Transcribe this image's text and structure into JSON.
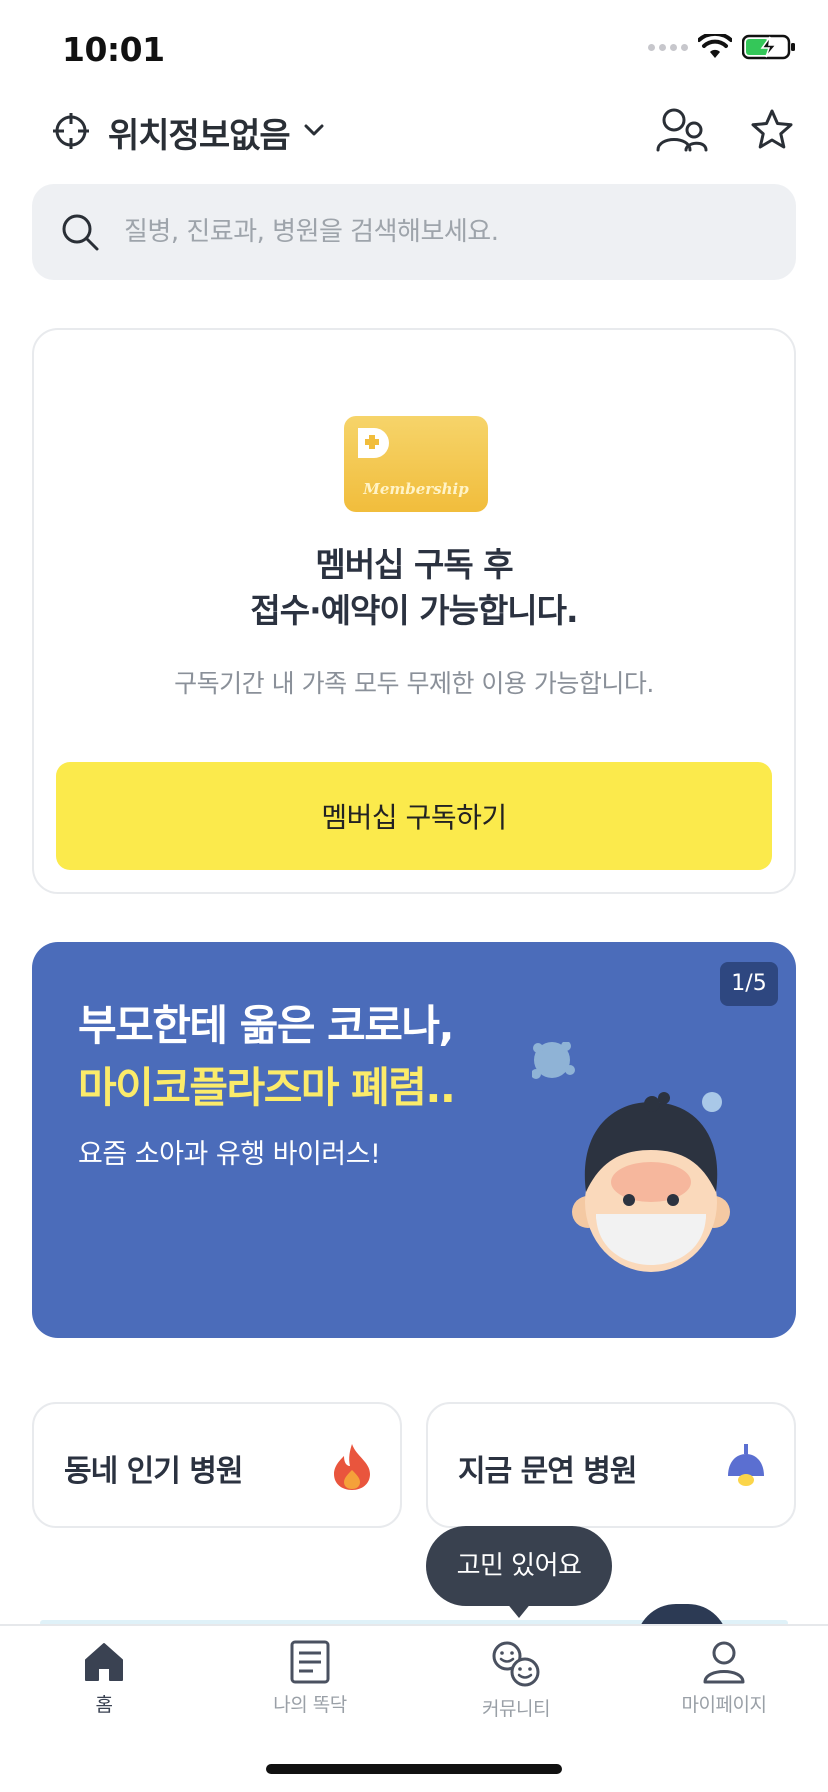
{
  "status_bar": {
    "time": "10:01"
  },
  "header": {
    "location_label": "위치정보없음"
  },
  "search": {
    "placeholder": "질병, 진료과, 병원을 검색해보세요."
  },
  "membership": {
    "badge_text": "Membership",
    "title_line1": "멤버십 구독 후",
    "title_line2": "접수·예약이 가능합니다.",
    "subtitle": "구독기간 내 가족 모두 무제한 이용 가능합니다.",
    "button_label": "멤버십 구독하기"
  },
  "banner": {
    "counter": "1/5",
    "title_line1": "부모한테 옮은 코로나,",
    "title_line2": "마이코플라즈마 폐렴..",
    "subtitle": "요즘 소아과 유행 바이러스!"
  },
  "tiles": [
    {
      "label": "동네 인기 병원",
      "icon": "fire-icon"
    },
    {
      "label": "지금 문연 병원",
      "icon": "lamp-icon"
    }
  ],
  "tooltip": {
    "text": "고민 있어요"
  },
  "tabbar": {
    "tabs": [
      {
        "label": "홈",
        "icon": "home-icon",
        "active": true
      },
      {
        "label": "나의 똑닥",
        "icon": "document-icon",
        "active": false
      },
      {
        "label": "커뮤니티",
        "icon": "community-icon",
        "active": false
      },
      {
        "label": "마이페이지",
        "icon": "user-icon",
        "active": false
      }
    ]
  },
  "colors": {
    "accent_yellow": "#fbea4c",
    "banner_blue": "#4b6cba",
    "banner_highlight": "#fbeb6a",
    "text_dark": "#2b3240"
  }
}
